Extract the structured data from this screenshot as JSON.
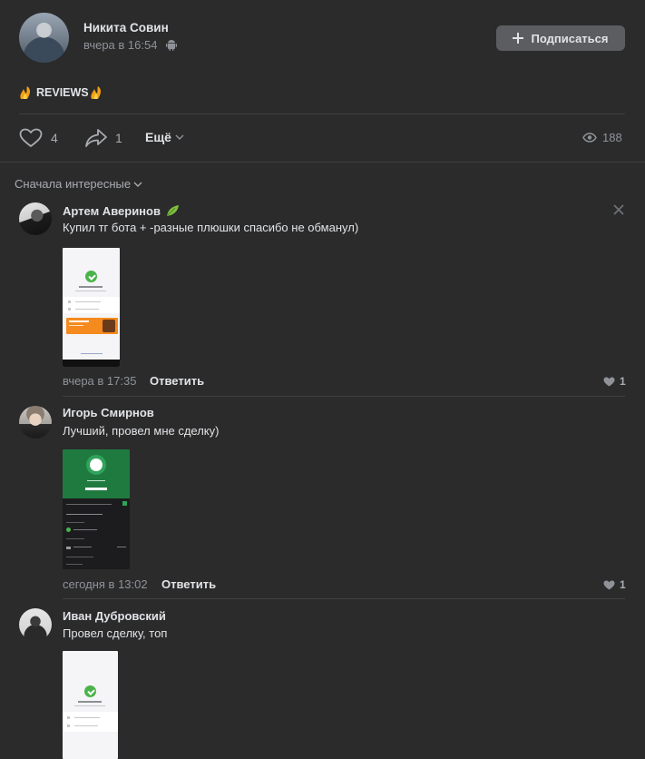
{
  "post": {
    "author": "Никита Совин",
    "time": "вчера в 16:54",
    "subscribe_label": "Подписаться",
    "text": "REVIEWS",
    "likes": "4",
    "shares": "1",
    "more_label": "Ещё",
    "views": "188"
  },
  "comments_sort": "Сначала интересные",
  "comments": [
    {
      "author": "Артем Аверинов",
      "text": "Купил тг бота + -разные плюшки спасибо не обманул)",
      "time": "вчера в 17:35",
      "reply_label": "Ответить",
      "likes": "1"
    },
    {
      "author": "Игорь Смирнов",
      "text": "Лучший, провел мне сделку)",
      "time": "сегодня в 13:02",
      "reply_label": "Ответить",
      "likes": "1"
    },
    {
      "author": "Иван Дубровский",
      "text": "Провел сделку, топ"
    }
  ],
  "colors": {
    "background": "#2b2b2c",
    "subscribe_button": "#5b5d61",
    "text_primary": "#e1e3e6",
    "text_secondary": "#8f9399",
    "success_green": "#4bb34b"
  },
  "icons": {
    "like": "heart-icon",
    "share": "share-arrow-icon",
    "views": "eye-icon",
    "platform": "android-icon",
    "leaf": "leaf-icon",
    "fire": "fire-icon"
  }
}
